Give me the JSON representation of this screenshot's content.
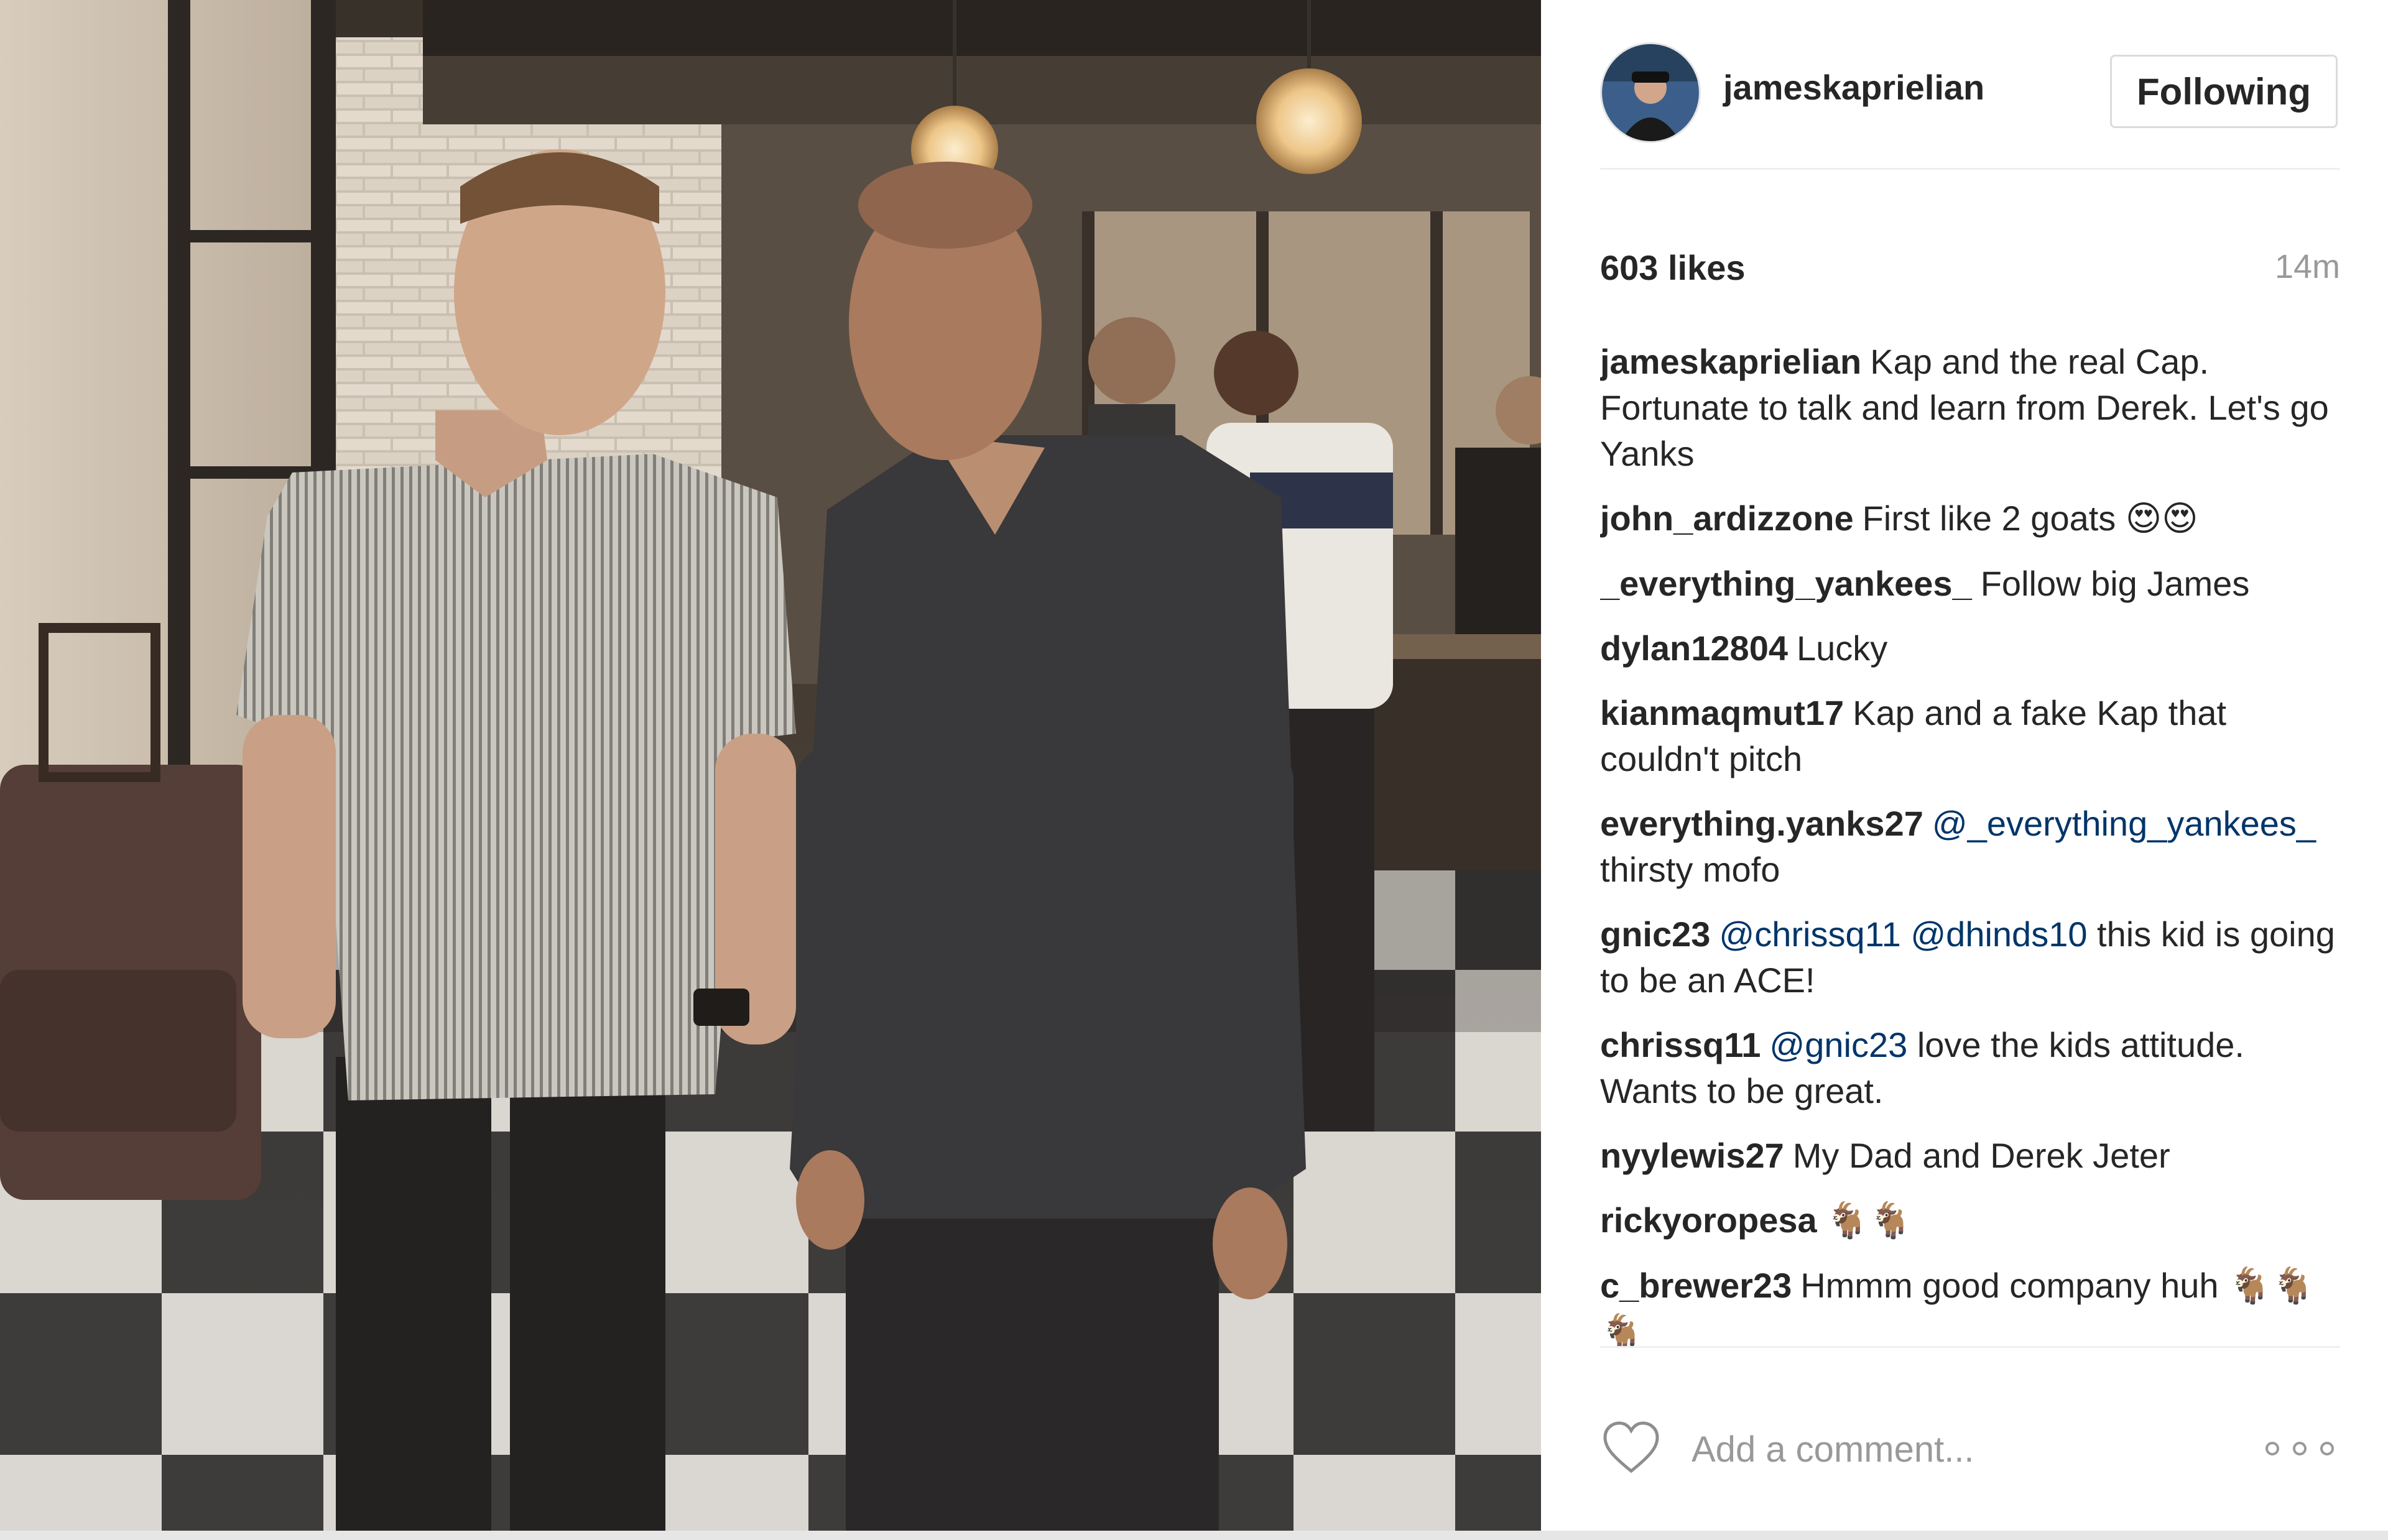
{
  "post": {
    "username": "jameskaprielian",
    "follow_label": "Following",
    "likes": "603 likes",
    "time": "14m",
    "caption": {
      "user": "jameskaprielian",
      "text": "Kap and the real Cap. Fortunate to talk and learn from Derek. Let's go Yanks"
    }
  },
  "comments": [
    {
      "user": "john_ardizzone",
      "text": "First like 2 goats",
      "emoji": "😍😍"
    },
    {
      "user": "_everything_yankees_",
      "text": "Follow big James"
    },
    {
      "user": "dylan12804",
      "text": "Lucky"
    },
    {
      "user": "kianmaqmut17",
      "text": "Kap and a fake Kap that couldn't pitch"
    },
    {
      "user": "everything.yanks27",
      "mention": "@_everything_yankees_",
      "text": "thirsty mofo"
    },
    {
      "user": "gnic23",
      "mention": "@chrissq11",
      "mention2": "@dhinds10",
      "text": "this kid is going to be an ACE!"
    },
    {
      "user": "chrissq11",
      "mention": "@gnic23",
      "text": "love the kids attitude. Wants to be great."
    },
    {
      "user": "nyylewis27",
      "text": "My Dad and Derek Jeter"
    },
    {
      "user": "rickyoropesa",
      "emoji": "🐐🐐"
    },
    {
      "user": "c_brewer23",
      "text": "Hmmm good company huh",
      "emoji": "🐐🐐🐐"
    }
  ],
  "footer": {
    "comment_placeholder": "Add a comment..."
  },
  "colors": {
    "text": "#262626",
    "muted": "#999999",
    "mention": "#003569",
    "border": "#dbdbdb"
  },
  "icons": [
    "avatar",
    "heart-icon",
    "more-options-icon"
  ]
}
